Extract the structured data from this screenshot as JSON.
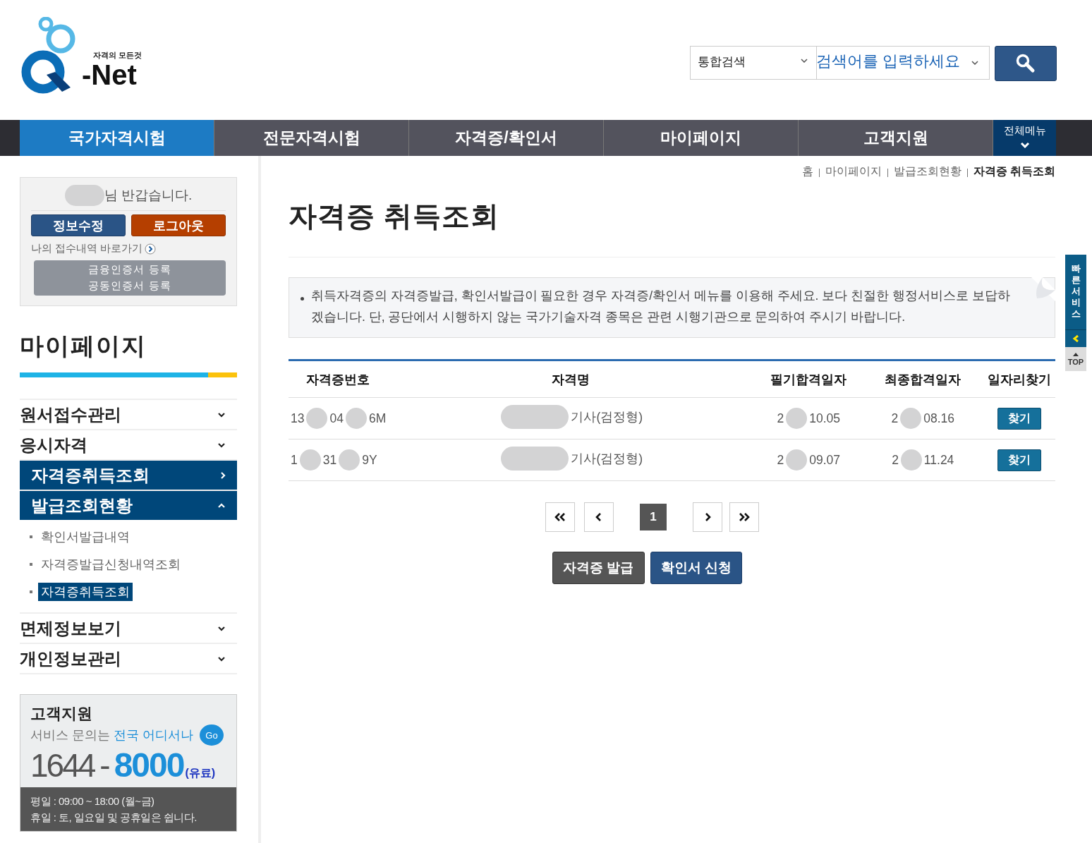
{
  "header": {
    "logo": {
      "tagline": "자격의 모든것",
      "wordmark": "-Net"
    },
    "search": {
      "scope": "통합검색",
      "placeholder": "검색어를 입력하세요"
    }
  },
  "nav": {
    "items": [
      {
        "label": "국가자격시험",
        "selected": true
      },
      {
        "label": "전문자격시험",
        "selected": false
      },
      {
        "label": "자격증/확인서",
        "selected": false
      },
      {
        "label": "마이페이지",
        "selected": false
      },
      {
        "label": "고객지원",
        "selected": false
      }
    ],
    "all_menu": "전체메뉴"
  },
  "user_box": {
    "greeting": "님 반갑습니다.",
    "edit_button": "정보수정",
    "logout_button": "로그아웃",
    "shortcut": "나의 접수내역 바로가기",
    "cert_buttons": [
      "금융인증서 등록",
      "공동인증서 등록"
    ]
  },
  "sidebar": {
    "title": "마이페이지",
    "items": [
      {
        "label": "원서접수관리",
        "kind": "folder",
        "expanded": false,
        "selected": false
      },
      {
        "label": "응시자격",
        "kind": "folder",
        "expanded": false,
        "selected": false
      },
      {
        "label": "자격증취득조회",
        "kind": "link",
        "selected": true
      },
      {
        "label": "발급조회현황",
        "kind": "folder",
        "expanded": true,
        "selected": true,
        "children": [
          {
            "label": "확인서발급내역",
            "selected": false
          },
          {
            "label": "자격증발급신청내역조회",
            "selected": false
          },
          {
            "label": "자격증취득조회",
            "selected": true
          }
        ]
      },
      {
        "label": "면제정보보기",
        "kind": "folder",
        "expanded": false,
        "selected": false
      },
      {
        "label": "개인정보관리",
        "kind": "folder",
        "expanded": false,
        "selected": false
      }
    ]
  },
  "support": {
    "title": "고객지원",
    "line_start": "서비스 문의는",
    "line_highlight": "전국 어디서나",
    "go": "Go",
    "phone_start": "1644",
    "phone_dash": "-",
    "phone_end": "8000",
    "paid": "(유료)",
    "hours": [
      "평일 : 09:00 ~ 18:00 (월~금)",
      "휴일 : 토, 일요일 및 공휴일은 쉽니다."
    ]
  },
  "breadcrumb": [
    "홈",
    "마이페이지",
    "발급조회현황",
    "자격증 취득조회"
  ],
  "page_title": "자격증 취득조회",
  "notice": "취득자격증의 자격증발급, 확인서발급이 필요한 경우 자격증/확인서 메뉴를 이용해 주세요. 보다 친절한 행정서비스로 보답하겠습니다. 단, 공단에서 시행하지 않는 국가기술자격 종목은 관련 시행기관으로 문의하여 주시기 바랍니다.",
  "table": {
    "columns": [
      "자격증번호",
      "자격명",
      "필기합격일자",
      "최종합격일자",
      "일자리찾기"
    ],
    "rows": [
      {
        "number": [
          "13",
          "04",
          "6M"
        ],
        "name": "기사(검정형)",
        "written": [
          "2",
          "10.05"
        ],
        "final": [
          "2",
          "08.16"
        ],
        "action": "찾기"
      },
      {
        "number": [
          "1",
          "31",
          "9Y"
        ],
        "name": "기사(검정형)",
        "written": [
          "2",
          "09.07"
        ],
        "final": [
          "2",
          "11.24"
        ],
        "action": "찾기"
      }
    ]
  },
  "pagination": {
    "pages": [
      {
        "label": "1",
        "selected": true
      }
    ]
  },
  "actions": [
    "자격증 발급",
    "확인서 신청"
  ],
  "quick_service": {
    "label": "빠른서비스",
    "top": "TOP"
  }
}
